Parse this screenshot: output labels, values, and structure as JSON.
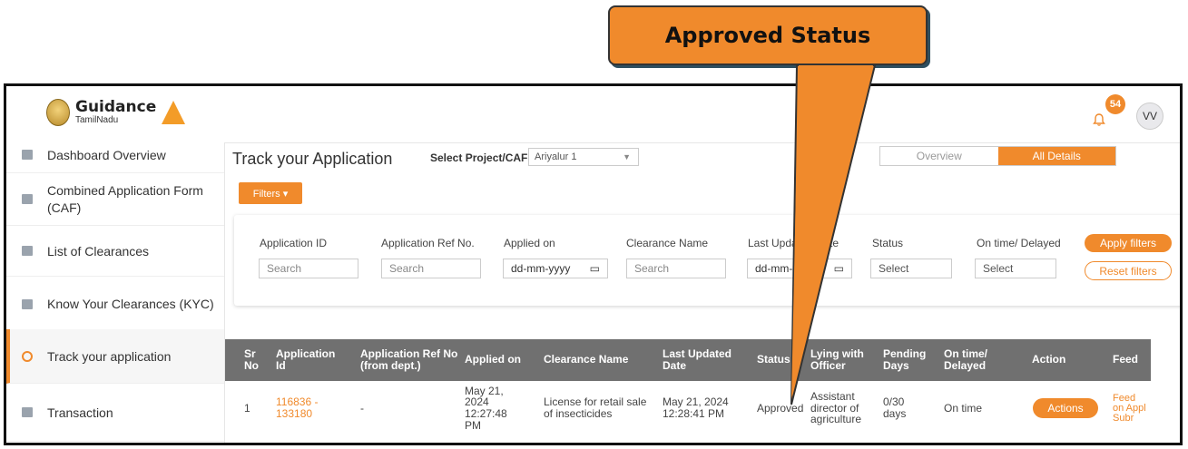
{
  "callout": {
    "text": "Approved Status"
  },
  "header": {
    "logo_main": "Guidance",
    "logo_sub": "TamilNadu",
    "notification_count": "54",
    "avatar_initials": "VV"
  },
  "sidebar": {
    "items": [
      {
        "label": "Dashboard Overview"
      },
      {
        "label": "Combined Application Form (CAF)"
      },
      {
        "label": "List of Clearances"
      },
      {
        "label": "Know Your Clearances (KYC)"
      },
      {
        "label": "Track your application"
      },
      {
        "label": "Transaction"
      }
    ]
  },
  "main": {
    "title": "Track your Application",
    "project_label": "Select Project/CAF",
    "project_value": "Ariyalur 1",
    "tabs": [
      {
        "label": "Overview"
      },
      {
        "label": "All Details"
      }
    ],
    "filters_button": "Filters ▾"
  },
  "filters": {
    "fields": [
      {
        "label": "Application ID",
        "placeholder": "Search"
      },
      {
        "label": "Application Ref No.",
        "placeholder": "Search"
      },
      {
        "label": "Applied on",
        "placeholder": "dd-mm-yyyy"
      },
      {
        "label": "Clearance Name",
        "placeholder": "Search"
      },
      {
        "label": "Last Updated Date",
        "placeholder": "dd-mm-yyyy"
      },
      {
        "label": "Status",
        "placeholder": "Select"
      },
      {
        "label": "On time/ Delayed",
        "placeholder": "Select"
      }
    ],
    "apply_label": "Apply filters",
    "reset_label": "Reset filters"
  },
  "table": {
    "headers": [
      "Sr No",
      "Application Id",
      "Application Ref No (from dept.)",
      "Applied on",
      "Clearance Name",
      "Last Updated Date",
      "Status",
      "Lying with Officer",
      "Pending Days",
      "On time/ Delayed",
      "Action",
      "Feed"
    ],
    "rows": [
      {
        "sr": "1",
        "app_id": "116836 - 133180",
        "ref_no": "-",
        "applied_on": "May 21, 2024 12:27:48 PM",
        "clearance": "License for retail sale of insecticides",
        "last_updated": "May 21, 2024 12:28:41 PM",
        "status": "Approved",
        "officer": "Assistant director of agriculture",
        "pending": "0/30 days",
        "ontime": "On time",
        "action": "Actions",
        "feedback": "Feed on Appl Subr"
      }
    ]
  },
  "colors": {
    "accent": "#f08a2c",
    "header_bg": "#707070",
    "arrow": "#f08a2c"
  }
}
